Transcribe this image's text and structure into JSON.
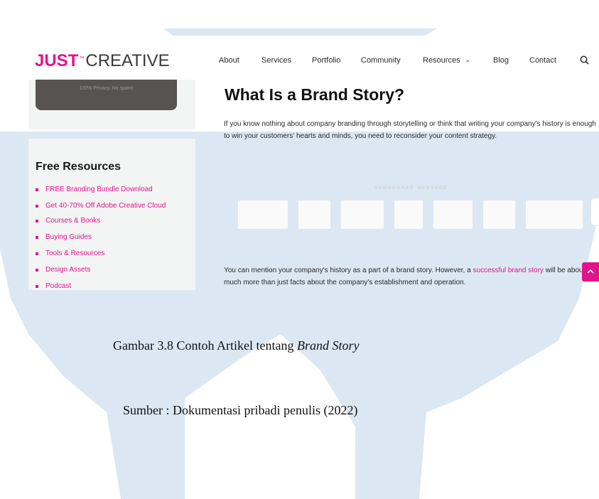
{
  "navbar": {
    "logo_bold": "JUST",
    "logo_tm": "™",
    "logo_light": "CREATIVE",
    "links": [
      {
        "label": "About"
      },
      {
        "label": "Services"
      },
      {
        "label": "Portfolio"
      },
      {
        "label": "Community"
      },
      {
        "label": "Resources"
      },
      {
        "label": "Blog"
      },
      {
        "label": "Contact"
      }
    ],
    "search_icon": "search-icon"
  },
  "sidebar": {
    "promo_note": "100% Privacy. No spam!",
    "resources_title": "Free Resources",
    "items": [
      {
        "label": "FREE Branding Bundle Download"
      },
      {
        "label": "Get 40-70% Off Adobe Creative Cloud"
      },
      {
        "label": "Courses & Books"
      },
      {
        "label": "Buying Guides"
      },
      {
        "label": "Tools & Resources"
      },
      {
        "label": "Design Assets"
      },
      {
        "label": "Podcast"
      }
    ]
  },
  "article": {
    "title": "What Is a Brand Story?",
    "paragraph1": "If you know nothing about company branding through storytelling or think that writing your company's history is enough to win your customers' hearts and minds, you need to reconsider your content strategy.",
    "sponsored_label": "SPONSORED MESSAGE",
    "paragraph2_start": "You can mention your company's history as a part of a brand story. However, a ",
    "paragraph2_link": "successful brand story",
    "paragraph2_end": " will be about much more than just facts about the company's establishment and operation."
  },
  "caption": {
    "line1_prefix": "Gambar 3.8 Contoh Artikel tentang ",
    "line1_italic": "Brand Story",
    "line2": "Sumber : Dokumentasi pribadi penulis (2022)"
  },
  "colors": {
    "accent": "#e4138c",
    "watermark": "#dbe8f3",
    "sidebar_bg": "#f3f4f4"
  }
}
